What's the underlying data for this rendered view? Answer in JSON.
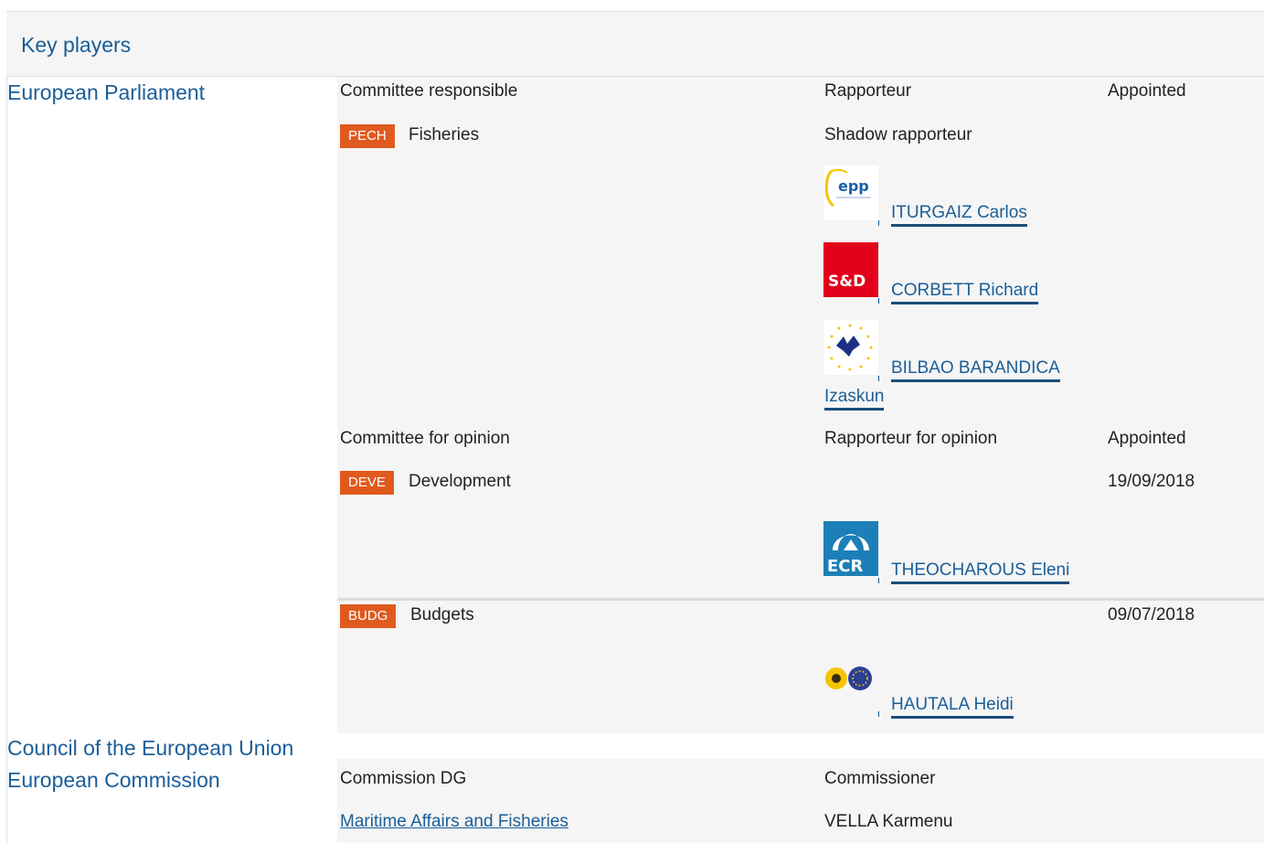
{
  "header": {
    "title": "Key players"
  },
  "institutions": {
    "ep": "European Parliament",
    "council": "Council of the European Union",
    "commission": "European Commission"
  },
  "responsible": {
    "committee_header": "Committee responsible",
    "rapporteur_header": "Rapporteur",
    "appointed_header": "Appointed",
    "committee_code": "PECH",
    "committee_name": "Fisheries",
    "shadow_header": "Shadow rapporteur",
    "shadows": [
      {
        "name": "ITURGAIZ Carlos",
        "group_logo": "epp",
        "logo_text": "epp"
      },
      {
        "name": "CORBETT Richard",
        "group_logo": "s-and-d",
        "logo_text": "S&D"
      },
      {
        "name_line1": "BILBAO BARANDICA",
        "name_line2": "Izaskun",
        "group_logo": "alde"
      }
    ]
  },
  "opinion": {
    "committee_header": "Committee for opinion",
    "rapporteur_header": "Rapporteur for opinion",
    "appointed_header": "Appointed",
    "committees": [
      {
        "code": "DEVE",
        "name": "Development",
        "appointed": "19/09/2018",
        "rapporteur": "THEOCHAROUS Eleni",
        "group_logo": "ecr",
        "logo_text": "ECR"
      },
      {
        "code": "BUDG",
        "name": "Budgets",
        "appointed": "09/07/2018",
        "rapporteur": "HAUTALA Heidi",
        "group_logo": "greens-efa"
      }
    ]
  },
  "commission": {
    "dg_header": "Commission DG",
    "commissioner_header": "Commissioner",
    "dg": "Maritime Affairs and Fisheries",
    "commissioner": "VELLA Karmenu"
  },
  "colors": {
    "link": "#1b5e98",
    "badge": "#e05a1e",
    "panel": "#f5f5f5",
    "sd_red": "#e3001b",
    "ecr_blue": "#1d7fb7"
  }
}
